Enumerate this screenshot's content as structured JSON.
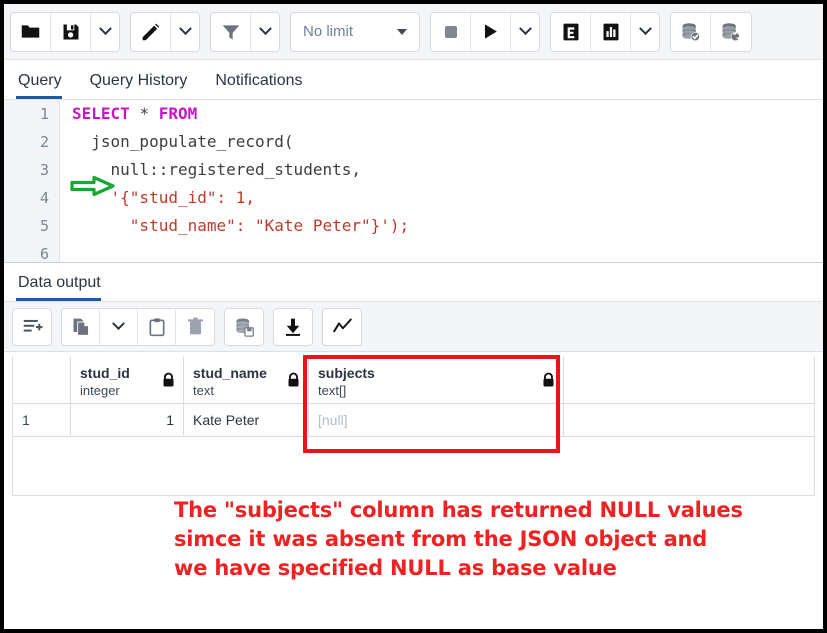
{
  "toolbar": {
    "groups": [
      {
        "name": "file-group",
        "buttons": [
          {
            "name": "open-file-button",
            "icon": "folder-icon",
            "label": ""
          },
          {
            "name": "save-file-button",
            "icon": "save-icon",
            "label": ""
          },
          {
            "name": "save-options-dropdown",
            "icon": "chevron-down-icon",
            "label": ""
          }
        ]
      },
      {
        "name": "edit-group",
        "buttons": [
          {
            "name": "edit-button",
            "icon": "pencil-icon",
            "label": ""
          },
          {
            "name": "edit-options-dropdown",
            "icon": "chevron-down-icon",
            "label": ""
          }
        ]
      },
      {
        "name": "filter-group",
        "buttons": [
          {
            "name": "filter-button",
            "icon": "funnel-icon",
            "label": ""
          },
          {
            "name": "filter-options-dropdown",
            "icon": "chevron-down-icon",
            "label": ""
          }
        ]
      },
      {
        "name": "rowlimit-group",
        "buttons": [
          {
            "name": "row-limit-select",
            "icon": "triangle-down-icon",
            "label": "No limit"
          }
        ]
      },
      {
        "name": "execute-group",
        "buttons": [
          {
            "name": "stop-query-button",
            "icon": "stop-square-icon",
            "label": ""
          },
          {
            "name": "execute-query-button",
            "icon": "play-icon",
            "label": ""
          },
          {
            "name": "execute-options-dropdown",
            "icon": "chevron-down-icon",
            "label": ""
          }
        ]
      },
      {
        "name": "explain-group",
        "buttons": [
          {
            "name": "explain-button",
            "icon": "explain-e-icon",
            "label": ""
          },
          {
            "name": "explain-analyze-button",
            "icon": "bar-chart-icon",
            "label": ""
          },
          {
            "name": "explain-options-dropdown",
            "icon": "chevron-down-icon",
            "label": ""
          }
        ]
      },
      {
        "name": "transaction-group",
        "buttons": [
          {
            "name": "commit-button",
            "icon": "database-check-icon",
            "label": ""
          },
          {
            "name": "rollback-button",
            "icon": "database-rollback-icon",
            "label": ""
          }
        ]
      }
    ],
    "row_limit_value": "No limit"
  },
  "tabs": {
    "items": [
      {
        "label": "Query",
        "active": true
      },
      {
        "label": "Query History",
        "active": false
      },
      {
        "label": "Notifications",
        "active": false
      }
    ]
  },
  "editor": {
    "line_numbers": [
      "1",
      "2",
      "3",
      "4",
      "5",
      "6"
    ],
    "lines": [
      {
        "n": "1",
        "tokens": [
          {
            "t": "SELECT",
            "c": "kw"
          },
          {
            "t": " ",
            "c": "plain"
          },
          {
            "t": "*",
            "c": "op"
          },
          {
            "t": " ",
            "c": "plain"
          },
          {
            "t": "FROM",
            "c": "kw"
          }
        ]
      },
      {
        "n": "2",
        "tokens": [
          {
            "t": "  json_populate_record(",
            "c": "plain"
          }
        ]
      },
      {
        "n": "3",
        "tokens": [
          {
            "t": "    null::registered_students,",
            "c": "plain"
          }
        ]
      },
      {
        "n": "4",
        "tokens": [
          {
            "t": "    ",
            "c": "plain"
          },
          {
            "t": "'{\"stud_id\": 1,",
            "c": "str"
          }
        ]
      },
      {
        "n": "5",
        "tokens": [
          {
            "t": "      ",
            "c": "plain"
          },
          {
            "t": "\"stud_name\": \"Kate Peter\"}');",
            "c": "str"
          }
        ]
      }
    ],
    "marker": "green-right-arrow"
  },
  "data_output": {
    "tab_label": "Data output",
    "toolbar_groups": [
      {
        "name": "add-row-group",
        "buttons": [
          {
            "name": "add-row-button",
            "icon": "add-row-icon"
          }
        ]
      },
      {
        "name": "copy-group",
        "buttons": [
          {
            "name": "copy-button",
            "icon": "copy-icon"
          },
          {
            "name": "copy-options-dropdown",
            "icon": "chevron-down-icon"
          },
          {
            "name": "paste-button",
            "icon": "clipboard-icon"
          },
          {
            "name": "delete-row-button",
            "icon": "trash-icon"
          }
        ]
      },
      {
        "name": "save-data-group",
        "buttons": [
          {
            "name": "save-data-changes-button",
            "icon": "database-save-icon"
          }
        ]
      },
      {
        "name": "download-group",
        "buttons": [
          {
            "name": "download-csv-button",
            "icon": "download-icon"
          }
        ]
      },
      {
        "name": "graph-group",
        "buttons": [
          {
            "name": "graph-visualiser-button",
            "icon": "line-chart-icon"
          }
        ]
      }
    ],
    "grid": {
      "columns": [
        {
          "name": "",
          "type": "",
          "locked": false
        },
        {
          "name": "stud_id",
          "type": "integer",
          "locked": true
        },
        {
          "name": "stud_name",
          "type": "text",
          "locked": true
        },
        {
          "name": "subjects",
          "type": "text[]",
          "locked": true
        }
      ],
      "rows": [
        {
          "rownum": "1",
          "stud_id": "1",
          "stud_name": "Kate Peter",
          "subjects": "[null]"
        }
      ]
    },
    "highlight_color": "#e8161a"
  },
  "annotation": {
    "color": "#ee2222",
    "lines": [
      "The \"subjects\" column has returned NULL values",
      "simce it was absent from the JSON object and",
      "we have specified NULL as base value"
    ]
  }
}
